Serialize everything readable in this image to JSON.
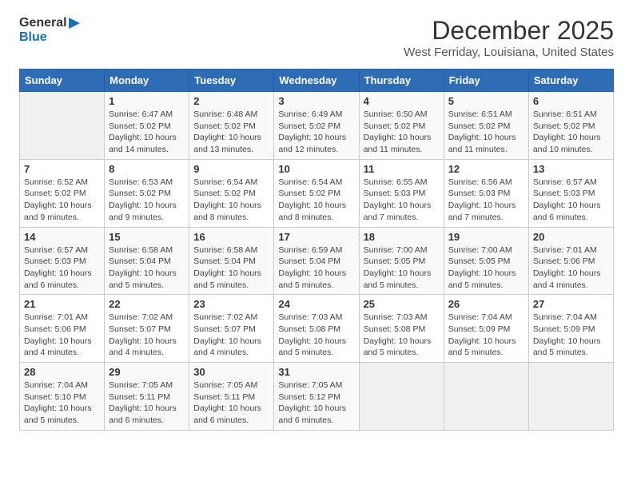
{
  "logo": {
    "line1": "General",
    "line2": "Blue"
  },
  "title": "December 2025",
  "location": "West Ferriday, Louisiana, United States",
  "days_of_week": [
    "Sunday",
    "Monday",
    "Tuesday",
    "Wednesday",
    "Thursday",
    "Friday",
    "Saturday"
  ],
  "weeks": [
    [
      {
        "day": "",
        "info": ""
      },
      {
        "day": "1",
        "info": "Sunrise: 6:47 AM\nSunset: 5:02 PM\nDaylight: 10 hours\nand 14 minutes."
      },
      {
        "day": "2",
        "info": "Sunrise: 6:48 AM\nSunset: 5:02 PM\nDaylight: 10 hours\nand 13 minutes."
      },
      {
        "day": "3",
        "info": "Sunrise: 6:49 AM\nSunset: 5:02 PM\nDaylight: 10 hours\nand 12 minutes."
      },
      {
        "day": "4",
        "info": "Sunrise: 6:50 AM\nSunset: 5:02 PM\nDaylight: 10 hours\nand 11 minutes."
      },
      {
        "day": "5",
        "info": "Sunrise: 6:51 AM\nSunset: 5:02 PM\nDaylight: 10 hours\nand 11 minutes."
      },
      {
        "day": "6",
        "info": "Sunrise: 6:51 AM\nSunset: 5:02 PM\nDaylight: 10 hours\nand 10 minutes."
      }
    ],
    [
      {
        "day": "7",
        "info": "Sunrise: 6:52 AM\nSunset: 5:02 PM\nDaylight: 10 hours\nand 9 minutes."
      },
      {
        "day": "8",
        "info": "Sunrise: 6:53 AM\nSunset: 5:02 PM\nDaylight: 10 hours\nand 9 minutes."
      },
      {
        "day": "9",
        "info": "Sunrise: 6:54 AM\nSunset: 5:02 PM\nDaylight: 10 hours\nand 8 minutes."
      },
      {
        "day": "10",
        "info": "Sunrise: 6:54 AM\nSunset: 5:02 PM\nDaylight: 10 hours\nand 8 minutes."
      },
      {
        "day": "11",
        "info": "Sunrise: 6:55 AM\nSunset: 5:03 PM\nDaylight: 10 hours\nand 7 minutes."
      },
      {
        "day": "12",
        "info": "Sunrise: 6:56 AM\nSunset: 5:03 PM\nDaylight: 10 hours\nand 7 minutes."
      },
      {
        "day": "13",
        "info": "Sunrise: 6:57 AM\nSunset: 5:03 PM\nDaylight: 10 hours\nand 6 minutes."
      }
    ],
    [
      {
        "day": "14",
        "info": "Sunrise: 6:57 AM\nSunset: 5:03 PM\nDaylight: 10 hours\nand 6 minutes."
      },
      {
        "day": "15",
        "info": "Sunrise: 6:58 AM\nSunset: 5:04 PM\nDaylight: 10 hours\nand 5 minutes."
      },
      {
        "day": "16",
        "info": "Sunrise: 6:58 AM\nSunset: 5:04 PM\nDaylight: 10 hours\nand 5 minutes."
      },
      {
        "day": "17",
        "info": "Sunrise: 6:59 AM\nSunset: 5:04 PM\nDaylight: 10 hours\nand 5 minutes."
      },
      {
        "day": "18",
        "info": "Sunrise: 7:00 AM\nSunset: 5:05 PM\nDaylight: 10 hours\nand 5 minutes."
      },
      {
        "day": "19",
        "info": "Sunrise: 7:00 AM\nSunset: 5:05 PM\nDaylight: 10 hours\nand 5 minutes."
      },
      {
        "day": "20",
        "info": "Sunrise: 7:01 AM\nSunset: 5:06 PM\nDaylight: 10 hours\nand 4 minutes."
      }
    ],
    [
      {
        "day": "21",
        "info": "Sunrise: 7:01 AM\nSunset: 5:06 PM\nDaylight: 10 hours\nand 4 minutes."
      },
      {
        "day": "22",
        "info": "Sunrise: 7:02 AM\nSunset: 5:07 PM\nDaylight: 10 hours\nand 4 minutes."
      },
      {
        "day": "23",
        "info": "Sunrise: 7:02 AM\nSunset: 5:07 PM\nDaylight: 10 hours\nand 4 minutes."
      },
      {
        "day": "24",
        "info": "Sunrise: 7:03 AM\nSunset: 5:08 PM\nDaylight: 10 hours\nand 5 minutes."
      },
      {
        "day": "25",
        "info": "Sunrise: 7:03 AM\nSunset: 5:08 PM\nDaylight: 10 hours\nand 5 minutes."
      },
      {
        "day": "26",
        "info": "Sunrise: 7:04 AM\nSunset: 5:09 PM\nDaylight: 10 hours\nand 5 minutes."
      },
      {
        "day": "27",
        "info": "Sunrise: 7:04 AM\nSunset: 5:09 PM\nDaylight: 10 hours\nand 5 minutes."
      }
    ],
    [
      {
        "day": "28",
        "info": "Sunrise: 7:04 AM\nSunset: 5:10 PM\nDaylight: 10 hours\nand 5 minutes."
      },
      {
        "day": "29",
        "info": "Sunrise: 7:05 AM\nSunset: 5:11 PM\nDaylight: 10 hours\nand 6 minutes."
      },
      {
        "day": "30",
        "info": "Sunrise: 7:05 AM\nSunset: 5:11 PM\nDaylight: 10 hours\nand 6 minutes."
      },
      {
        "day": "31",
        "info": "Sunrise: 7:05 AM\nSunset: 5:12 PM\nDaylight: 10 hours\nand 6 minutes."
      },
      {
        "day": "",
        "info": ""
      },
      {
        "day": "",
        "info": ""
      },
      {
        "day": "",
        "info": ""
      }
    ]
  ]
}
